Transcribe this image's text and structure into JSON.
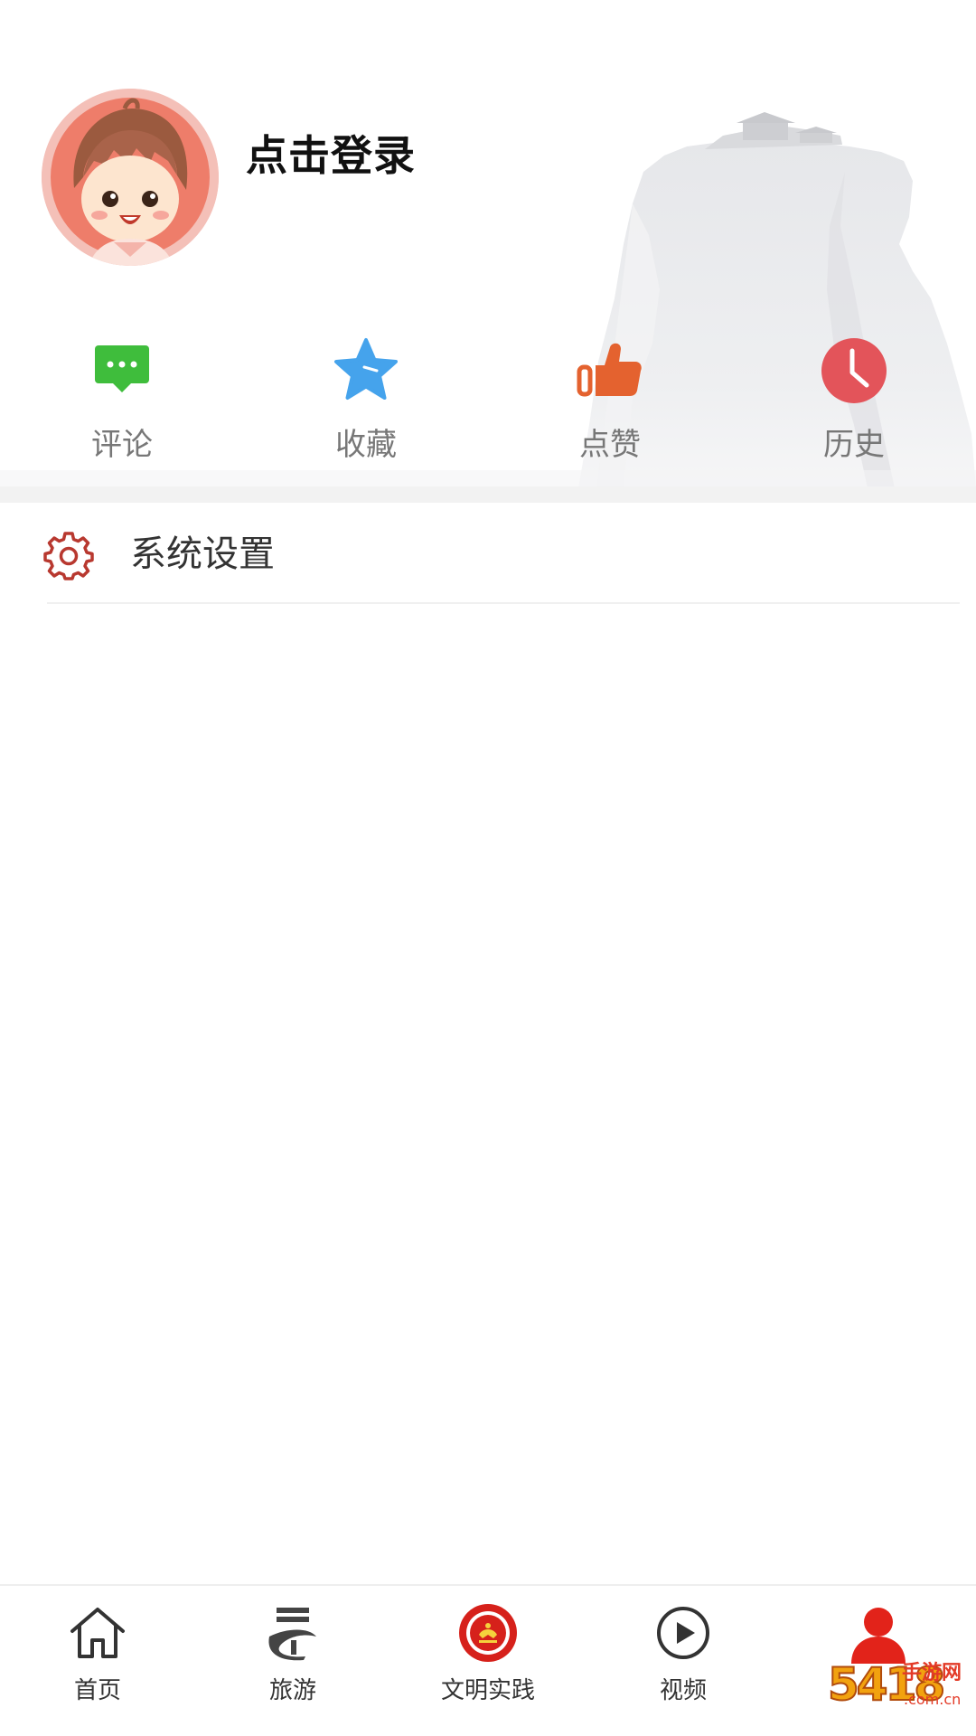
{
  "profile": {
    "login_label": "点击登录"
  },
  "quick_actions": [
    {
      "label": "评论",
      "icon": "comment-icon",
      "color": "#3fbd3c"
    },
    {
      "label": "收藏",
      "icon": "star-icon",
      "color": "#45a3ec"
    },
    {
      "label": "点赞",
      "icon": "thumbs-up-icon",
      "color": "#e4622f"
    },
    {
      "label": "历史",
      "icon": "clock-icon",
      "color": "#e3545a"
    }
  ],
  "settings": {
    "label": "系统设置",
    "icon": "gear-icon",
    "icon_color": "#b8382f"
  },
  "tabbar": {
    "items": [
      {
        "label": "首页",
        "icon": "home-icon"
      },
      {
        "label": "旅游",
        "icon": "travel-icon"
      },
      {
        "label": "文明实践",
        "icon": "civilization-badge-icon"
      },
      {
        "label": "视频",
        "icon": "play-icon"
      },
      {
        "label": "",
        "icon": "user-icon",
        "active": true,
        "active_color": "#e2231a"
      }
    ]
  },
  "watermark": {
    "number": "5418",
    "text": "手游网",
    "domain": ".com.cn"
  }
}
